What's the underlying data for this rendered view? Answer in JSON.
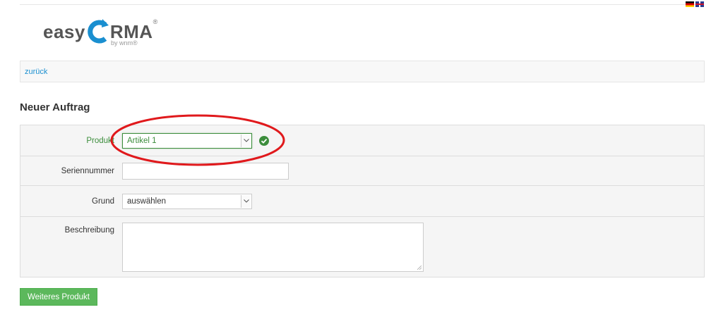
{
  "languages": [
    {
      "code": "de",
      "icon": "flag-germany-icon"
    },
    {
      "code": "en",
      "icon": "flag-uk-icon"
    }
  ],
  "logo": {
    "part1": "easy",
    "part2": "RMA",
    "registered": "®",
    "byline": "by wnm®",
    "accent_color": "#1a8fd0"
  },
  "navigation": {
    "back_label": "zurück"
  },
  "page": {
    "title": "Neuer Auftrag"
  },
  "form": {
    "product": {
      "label": "Produkt",
      "value": "Artikel 1",
      "status": "valid",
      "status_color": "#3c8d3c"
    },
    "serial": {
      "label": "Seriennummer",
      "value": ""
    },
    "reason": {
      "label": "Grund",
      "value": "auswählen"
    },
    "description": {
      "label": "Beschreibung",
      "value": ""
    }
  },
  "actions": {
    "add_product_label": "Weiteres Produkt",
    "button_color": "#5cb85c"
  },
  "annotation": {
    "shape": "ellipse",
    "color": "#e0191c"
  }
}
